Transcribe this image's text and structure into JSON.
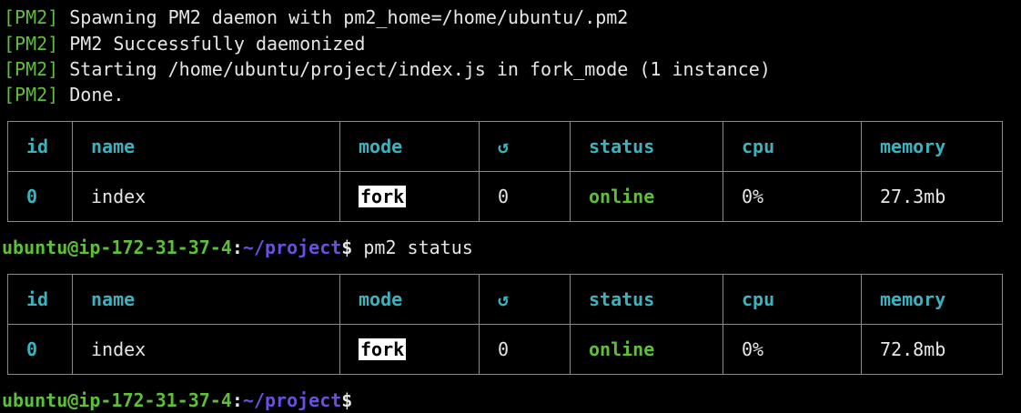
{
  "terminal": {
    "log_lines": [
      {
        "tag": "[PM2]",
        "text": " Spawning PM2 daemon with pm2_home=/home/ubuntu/.pm2"
      },
      {
        "tag": "[PM2]",
        "text": " PM2 Successfully daemonized"
      },
      {
        "tag": "[PM2]",
        "text": " Starting /home/ubuntu/project/index.js in fork_mode (1 instance)"
      },
      {
        "tag": "[PM2]",
        "text": " Done."
      }
    ],
    "table_headers": [
      "id",
      "name",
      "mode",
      "↺",
      "status",
      "cpu",
      "memory"
    ],
    "table1": {
      "row": {
        "id": "0",
        "name": "index",
        "mode": "fork",
        "restarts": "0",
        "status": "online",
        "cpu": "0%",
        "memory": "27.3mb"
      }
    },
    "prompt1": {
      "user_host": "ubuntu@ip-172-31-37-4",
      "sep": ":",
      "path": "~/project",
      "dollar": "$",
      "command": " pm2 status"
    },
    "table2": {
      "row": {
        "id": "0",
        "name": "index",
        "mode": "fork",
        "restarts": "0",
        "status": "online",
        "cpu": "0%",
        "memory": "72.8mb"
      }
    },
    "prompt2": {
      "user_host": "ubuntu@ip-172-31-37-4",
      "sep": ":",
      "path": "~/project",
      "dollar": "$"
    }
  },
  "colors": {
    "background": "#000000",
    "pm2_tag": "#5fbf3a",
    "header_cyan": "#3ab3bf",
    "status_green": "#5fbf3a",
    "prompt_path_purple": "#6c4fe0",
    "border_gray": "#8a8a8a"
  }
}
